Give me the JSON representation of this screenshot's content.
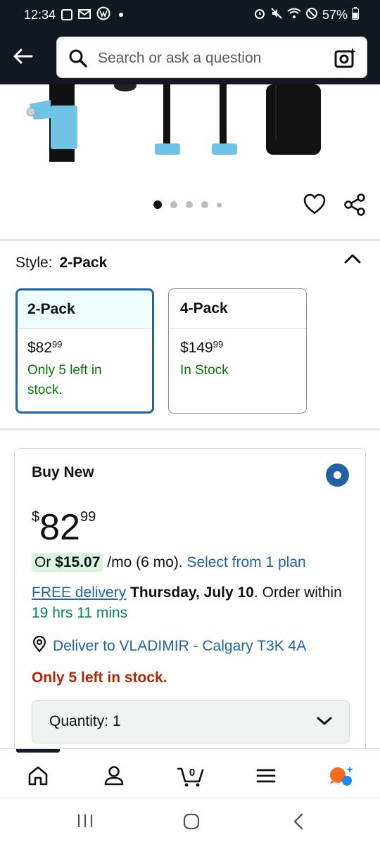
{
  "status_bar": {
    "time": "12:34",
    "battery": "57%"
  },
  "search": {
    "placeholder": "Search or ask a question"
  },
  "carousel": {
    "dot_count": 5,
    "active_index": 0
  },
  "style": {
    "label": "Style:",
    "value": "2-Pack"
  },
  "options": [
    {
      "name": "2-Pack",
      "price_dollars": "$82",
      "price_cents": "99",
      "stock_line1": "Only 5 left in",
      "stock_line2": "stock.",
      "selected": true
    },
    {
      "name": "4-Pack",
      "price_dollars": "$149",
      "price_cents": "99",
      "stock_line1": "In Stock",
      "stock_line2": "",
      "selected": false
    }
  ],
  "buy": {
    "title": "Buy New",
    "price_symbol": "$",
    "price_whole": "82",
    "price_cents": "99",
    "monthly_prefix": "Or ",
    "monthly_amount": "$15.07",
    "monthly_suffix": " /mo (6 mo). ",
    "plan_link": "Select from 1 plan",
    "free_delivery": "FREE delivery",
    "delivery_date": "Thursday, July 10",
    "order_text": ". Order within ",
    "countdown": "19 hrs 11 mins",
    "deliver_to": "Deliver to VLADIMIR - Calgary T3K 4A",
    "low_stock": "Only 5 left in stock.",
    "quantity_label": "Quantity: 1"
  },
  "bottom_nav": {
    "cart_count": "0",
    "items": [
      "home-icon",
      "account-icon",
      "cart-icon",
      "menu-icon",
      "rufus-icon"
    ]
  },
  "colors": {
    "header_bg": "#131921",
    "link": "#2162a1",
    "green": "#007600",
    "red": "#b12704",
    "selected_border": "#2162a1"
  }
}
